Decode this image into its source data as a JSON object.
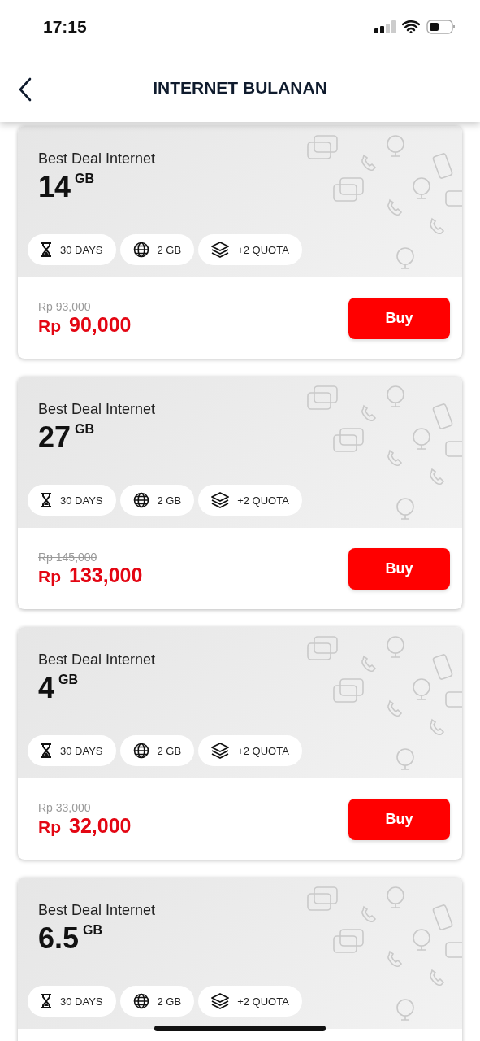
{
  "status_bar": {
    "time": "17:15"
  },
  "header": {
    "title": "INTERNET BULANAN"
  },
  "packages": [
    {
      "name": "Best Deal Internet",
      "quota": "14",
      "unit": "GB",
      "chips": [
        {
          "kind": "days",
          "label": "30 DAYS"
        },
        {
          "kind": "data",
          "label": "2 GB"
        },
        {
          "kind": "quota",
          "label": "+2 QUOTA"
        }
      ],
      "old_price": "Rp 93,000",
      "currency": "Rp",
      "price": "90,000",
      "button": "Buy"
    },
    {
      "name": "Best Deal Internet",
      "quota": "27",
      "unit": "GB",
      "chips": [
        {
          "kind": "days",
          "label": "30 DAYS"
        },
        {
          "kind": "data",
          "label": "2 GB"
        },
        {
          "kind": "quota",
          "label": "+2 QUOTA"
        }
      ],
      "old_price": "Rp 145,000",
      "currency": "Rp",
      "price": "133,000",
      "button": "Buy"
    },
    {
      "name": "Best Deal Internet",
      "quota": "4",
      "unit": "GB",
      "chips": [
        {
          "kind": "days",
          "label": "30 DAYS"
        },
        {
          "kind": "data",
          "label": "2 GB"
        },
        {
          "kind": "quota",
          "label": "+2 QUOTA"
        }
      ],
      "old_price": "Rp 33,000",
      "currency": "Rp",
      "price": "32,000",
      "button": "Buy"
    },
    {
      "name": "Best Deal Internet",
      "quota": "6.5",
      "unit": "GB",
      "chips": [
        {
          "kind": "days",
          "label": "30 DAYS"
        },
        {
          "kind": "data",
          "label": "2 GB"
        },
        {
          "kind": "quota",
          "label": "+2 QUOTA"
        }
      ]
    }
  ]
}
